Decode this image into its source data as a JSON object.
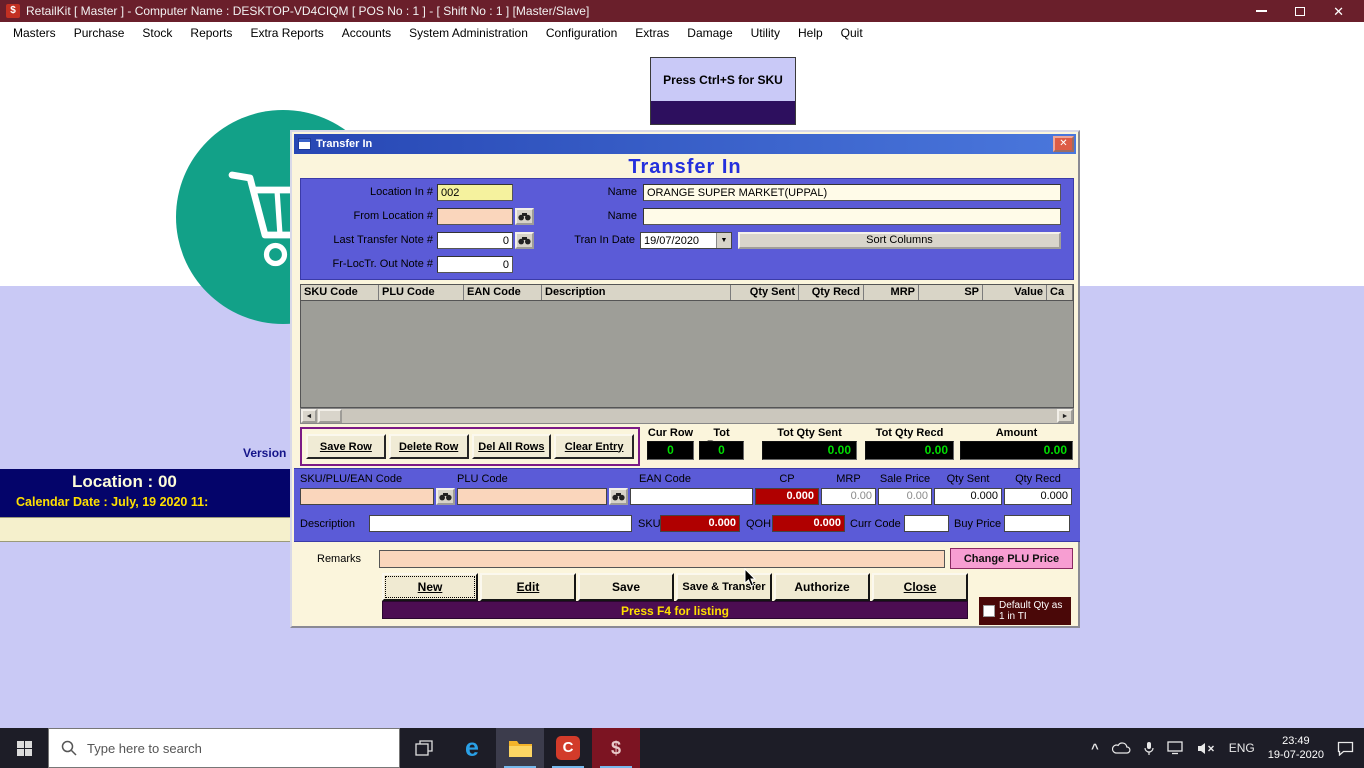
{
  "titlebar": {
    "icon_glyph": "$",
    "title": "RetailKit [ Master ] - Computer Name : DESKTOP-VD4CIQM [ POS No : 1 ] - [ Shift No : 1 ]  [Master/Slave]"
  },
  "menu": [
    "Masters",
    "Purchase",
    "Stock",
    "Reports",
    "Extra Reports",
    "Accounts",
    "System Administration",
    "Configuration",
    "Extras",
    "Damage",
    "Utility",
    "Help",
    "Quit"
  ],
  "background": {
    "sku_hint": "Press Ctrl+S for SKU",
    "version_label": "Version [",
    "location_line": "Location : 00",
    "calendar_line": "Calendar Date : July, 19 2020 11:"
  },
  "dialog": {
    "title": "Transfer In",
    "heading": "Transfer In",
    "fields": {
      "location_in_label": "Location In #",
      "location_in_value": "002",
      "name1_label": "Name",
      "name1_value": "ORANGE SUPER MARKET(UPPAL)",
      "from_location_label": "From Location #",
      "from_location_value": "",
      "name2_label": "Name",
      "name2_value": "",
      "last_note_label": "Last Transfer Note #",
      "last_note_value": "0",
      "tran_date_label": "Tran In Date",
      "tran_date_value": "19/07/2020",
      "sort_columns_label": "Sort  Columns",
      "fr_out_note_label": "Fr-LocTr. Out Note #",
      "fr_out_note_value": "0"
    },
    "table": {
      "columns": [
        "SKU Code",
        "PLU Code",
        "EAN Code",
        "Description",
        "Qty Sent",
        "Qty Recd",
        "MRP",
        "SP",
        "Value",
        "Ca"
      ]
    },
    "row_buttons": [
      "Save Row",
      "Delete Row",
      "Del All Rows",
      "Clear Entry"
    ],
    "stats": [
      {
        "label": "Cur Row",
        "value": "0"
      },
      {
        "label": "Tot Rows",
        "value": "0"
      },
      {
        "label": "Tot Qty Sent",
        "value": "0.00"
      },
      {
        "label": "Tot Qty Recd",
        "value": "0.00"
      },
      {
        "label": "Amount",
        "value": "0.00"
      }
    ],
    "entry": {
      "sku_plu_ean_label": "SKU/PLU/EAN Code",
      "plu_label": "PLU Code",
      "ean_label": "EAN Code",
      "cp_label": "CP",
      "cp_value": "0.000",
      "mrp_label": "MRP",
      "mrp_value": "0.00",
      "sale_price_label": "Sale Price",
      "sale_price_value": "0.00",
      "qty_sent_label": "Qty Sent",
      "qty_sent_value": "0.000",
      "qty_recd_label": "Qty Recd",
      "qty_recd_value": "0.000",
      "description_label": "Description",
      "sku_label": "SKU",
      "sku_value": "0.000",
      "qoh_label": "QOH",
      "qoh_value": "0.000",
      "curr_code_label": "Curr Code",
      "buy_price_label": "Buy Price"
    },
    "remarks_label": "Remarks",
    "change_plu_label": "Change PLU Price",
    "actions": [
      "New",
      "Edit",
      "Save",
      "Save & Transfer",
      "Authorize",
      "Close"
    ],
    "f4_hint": "Press F4 for listing",
    "default_qty_label": "Default Qty as 1 in TI"
  },
  "glyphs": {
    "close_x": "✕",
    "dropdown": "▼",
    "scroll_left": "◄",
    "scroll_right": "►",
    "chevron_up": "^",
    "edge": "e",
    "camtasia": "C",
    "dollar": "$"
  },
  "taskbar": {
    "search_placeholder": "Type here to search",
    "language": "ENG",
    "time": "23:49",
    "date": "19-07-2020"
  }
}
